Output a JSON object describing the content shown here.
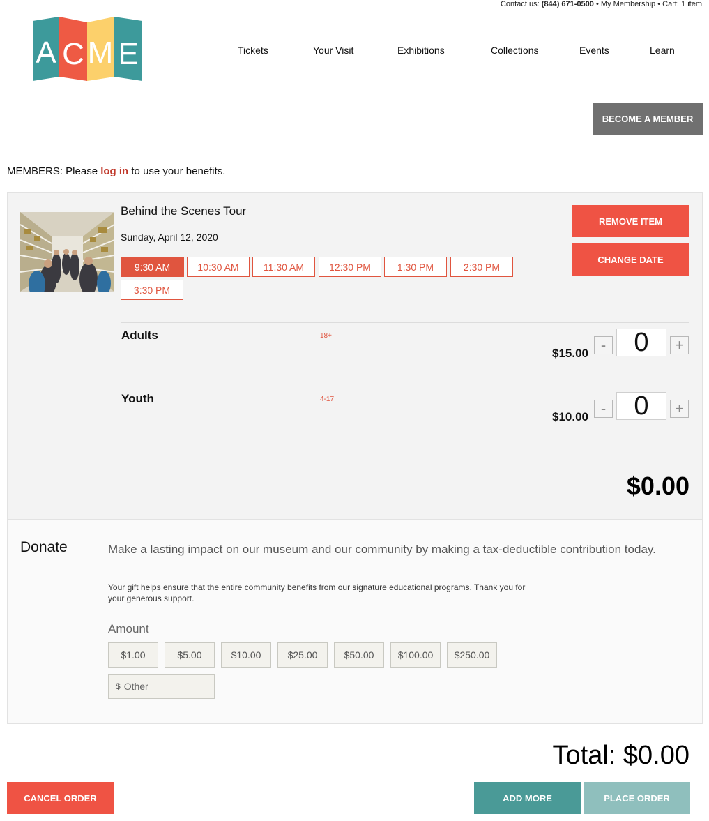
{
  "utility": {
    "contact_prefix": "Contact us:",
    "phone": "(844) 671-0500",
    "sep1": "•",
    "membership": "My Membership",
    "sep2": "•",
    "cart": "Cart: 1 item"
  },
  "logo": {
    "letters": [
      "A",
      "C",
      "M",
      "E"
    ],
    "colors": [
      "#3d9a9b",
      "#ee5a44",
      "#fcd06b",
      "#3d9a9b"
    ]
  },
  "nav": [
    "Tickets",
    "Your Visit",
    "Exhibitions",
    "Collections",
    "Events",
    "Learn"
  ],
  "become_member": "BECOME A MEMBER",
  "members": {
    "prefix": "MEMBERS: Please",
    "login": "log in",
    "suffix": "to use your benefits."
  },
  "item": {
    "title": "Behind the Scenes Tour",
    "date": "Sunday, April 12, 2020",
    "times": [
      "9:30 AM",
      "10:30 AM",
      "11:30 AM",
      "12:30 PM",
      "1:30 PM",
      "2:30 PM",
      "3:30 PM"
    ],
    "selected_time": "9:30 AM",
    "remove": "REMOVE ITEM",
    "change_date": "CHANGE DATE",
    "tickets": [
      {
        "name": "Adults",
        "age": "18+",
        "price": "$15.00",
        "qty": "0"
      },
      {
        "name": "Youth",
        "age": "4-17",
        "price": "$10.00",
        "qty": "0"
      }
    ],
    "minus": "-",
    "plus": "+",
    "subtotal": "$0.00"
  },
  "donate": {
    "heading": "Donate",
    "lead": "Make a lasting impact on our museum and our community by making a tax-deductible contribution today.",
    "sub": "Your gift helps ensure that the entire community benefits from our signature educational programs. Thank you for your generous support.",
    "amount_label": "Amount",
    "amounts": [
      "$1.00",
      "$5.00",
      "$10.00",
      "$25.00",
      "$50.00",
      "$100.00",
      "$250.00"
    ],
    "currency": "$",
    "other_placeholder": "Other"
  },
  "total": "Total: $0.00",
  "cancel": "CANCEL ORDER",
  "add_more": "ADD MORE",
  "place_order": "PLACE ORDER"
}
